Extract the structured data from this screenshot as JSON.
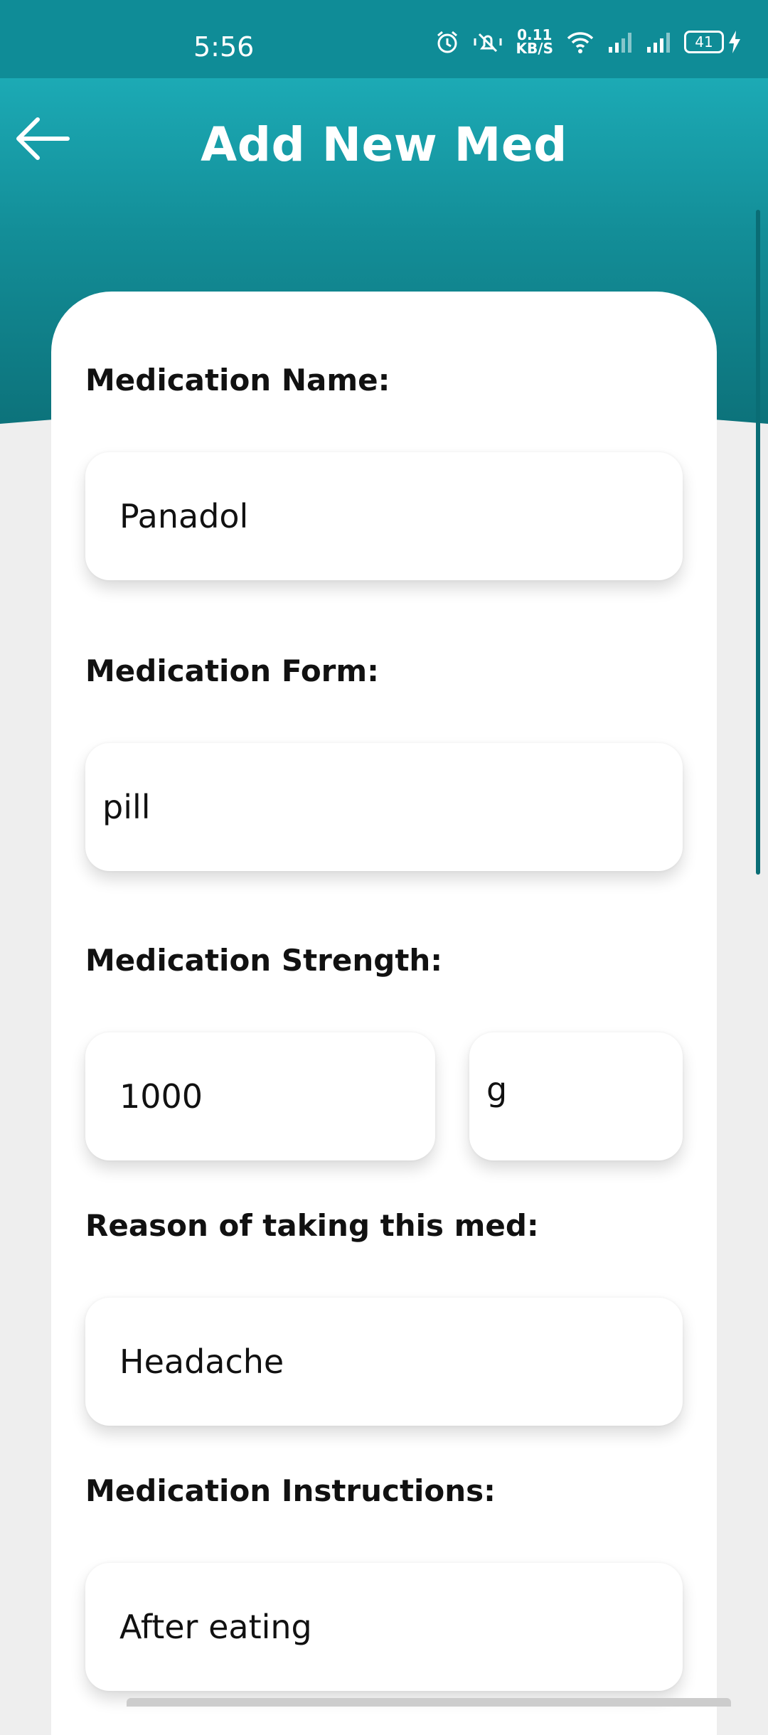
{
  "status_bar": {
    "time": "5:56",
    "net_speed_value": "0.11",
    "net_speed_unit": "KB/S",
    "battery": "41",
    "icons": [
      "alarm-icon",
      "mute-icon",
      "wifi-icon",
      "signal-icon",
      "signal-icon",
      "battery-icon",
      "charging-icon"
    ]
  },
  "header": {
    "title": "Add New Med",
    "back_icon": "arrow-left-icon"
  },
  "form": {
    "name_label": "Medication Name:",
    "name_value": "Panadol",
    "form_label": "Medication Form:",
    "form_value": "pill",
    "strength_label": "Medication Strength:",
    "strength_value": "1000",
    "strength_unit": "g",
    "reason_label": "Reason of taking this med:",
    "reason_value": "Headache",
    "instructions_label": "Medication Instructions:",
    "instructions_value": "After eating"
  },
  "colors": {
    "header_top": "#1caab5",
    "header_bottom": "#0b6d75",
    "status_bar": "#0f8c97",
    "card": "#ffffff",
    "background": "#eeeeee"
  }
}
